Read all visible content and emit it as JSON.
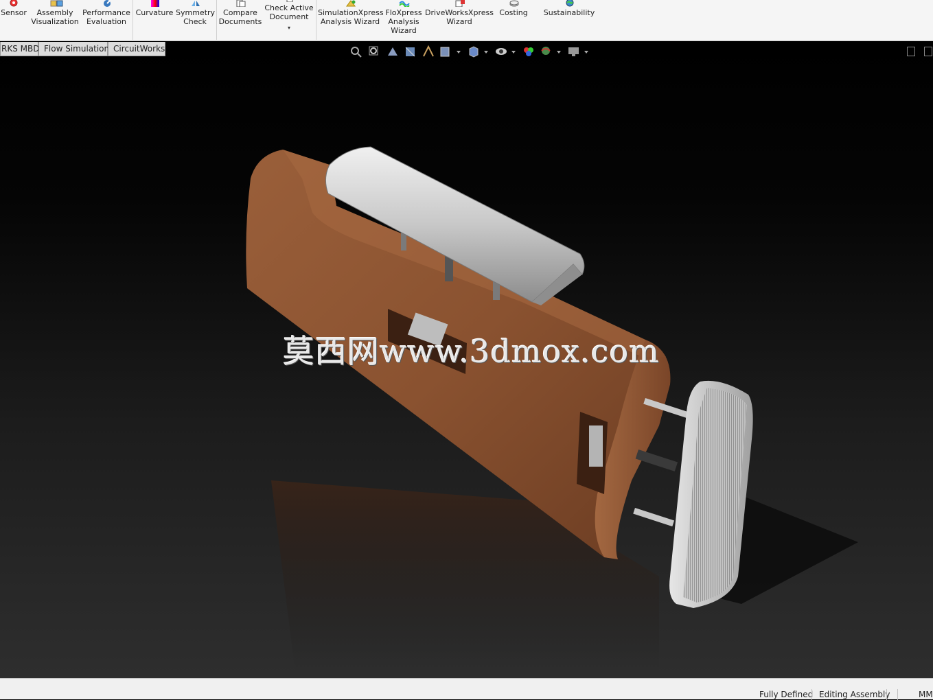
{
  "ribbon": {
    "tools": [
      {
        "label": "Sensor",
        "icon": "sensor-icon"
      },
      {
        "label": "Assembly\nVisualization",
        "icon": "assembly-visualization-icon"
      },
      {
        "label": "Performance\nEvaluation",
        "icon": "performance-evaluation-icon"
      },
      {
        "label": "Curvature",
        "icon": "curvature-icon"
      },
      {
        "label": "Symmetry\nCheck",
        "icon": "symmetry-check-icon"
      },
      {
        "label": "Compare\nDocuments",
        "icon": "compare-documents-icon"
      },
      {
        "label": "Check Active\nDocument",
        "icon": "check-active-document-icon"
      },
      {
        "label": "SimulationXpress\nAnalysis Wizard",
        "icon": "simulationxpress-icon"
      },
      {
        "label": "FloXpress\nAnalysis\nWizard",
        "icon": "floxpress-icon"
      },
      {
        "label": "DriveWorksXpress\nWizard",
        "icon": "driveworksxpress-icon"
      },
      {
        "label": "Costing",
        "icon": "costing-icon"
      },
      {
        "label": "Sustainability",
        "icon": "sustainability-icon"
      }
    ]
  },
  "tabs": [
    "RKS MBD",
    "Flow Simulation",
    "CircuitWorks"
  ],
  "heads_up_toolbar": [
    "zoom-to-fit-icon",
    "zoom-to-area-icon",
    "previous-view-icon",
    "section-view-icon",
    "dynamic-annotation-icon",
    "view-orientation-icon",
    "display-style-icon",
    "hide-show-items-icon",
    "edit-appearance-icon",
    "apply-scene-icon",
    "view-settings-icon"
  ],
  "viewport": {
    "watermark": "莫西网www.3dmox.com",
    "colors": {
      "wood": "#8a5230",
      "metal": "#c8c8c8",
      "background_top": "#000000",
      "background_bottom": "#2e2e2e"
    }
  },
  "status": {
    "defined": "Fully Defined",
    "mode": "Editing Assembly",
    "units": "MM"
  }
}
